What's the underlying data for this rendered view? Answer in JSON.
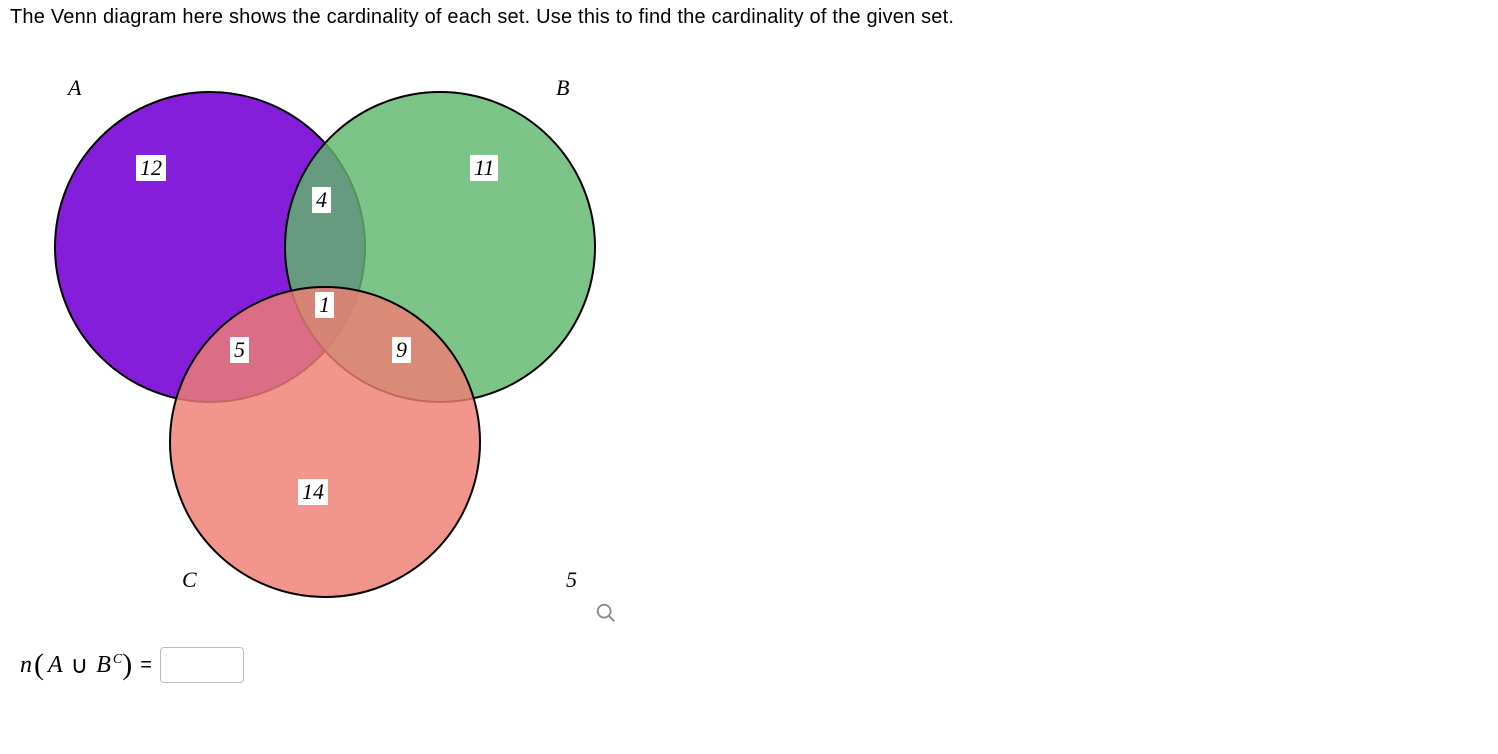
{
  "question": "The Venn diagram here shows the cardinality of each set. Use this to find the cardinality of the given set.",
  "labels": {
    "A": "A",
    "B": "B",
    "C": "C"
  },
  "venn": {
    "A_only": "12",
    "B_only": "11",
    "C_only": "14",
    "AB_only": "4",
    "AC_only": "5",
    "BC_only": "9",
    "ABC": "1",
    "outside": "5"
  },
  "expression": {
    "n": "n",
    "lparen": "(",
    "setA": "A",
    "union": "∪",
    "setB": "B",
    "sup": "C",
    "rparen": ")",
    "equals": "="
  },
  "answer_value": "",
  "colors": {
    "A": "#7a0bd8",
    "B": "#5fb76c",
    "C": "#ef7f74"
  }
}
